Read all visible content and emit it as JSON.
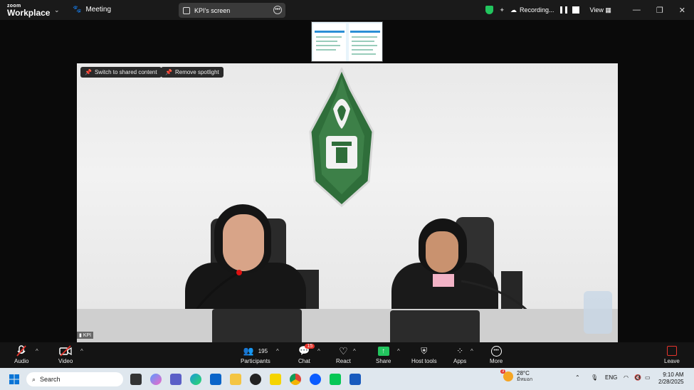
{
  "app": {
    "brand_top": "zoom",
    "brand_bottom": "Workplace",
    "meeting_label": "Meeting"
  },
  "share": {
    "label": "KPI's screen"
  },
  "status": {
    "recording_label": "Recording...",
    "view_label": "View"
  },
  "stage": {
    "switch_label": "Switch to shared content",
    "spotlight_label": "Remove spotlight",
    "participant_name": "KPI"
  },
  "toolbar": {
    "audio": "Audio",
    "video": "Video",
    "participants": "Participants",
    "participants_count": "195",
    "chat": "Chat",
    "chat_badge": "15",
    "react": "React",
    "share": "Share",
    "host_tools": "Host tools",
    "apps": "Apps",
    "more": "More",
    "leave": "Leave"
  },
  "taskbar": {
    "search_placeholder": "Search",
    "weather_temp": "28°C",
    "weather_cond": "มีหมอก",
    "weather_badge": "3",
    "lang": "ENG",
    "time": "9:10 AM",
    "date": "2/28/2025"
  },
  "colors": {
    "accent_green": "#22c55e",
    "leave_red": "#e5342c",
    "badge_red": "#e5342c",
    "zoom_blue": "#0b5cff"
  }
}
